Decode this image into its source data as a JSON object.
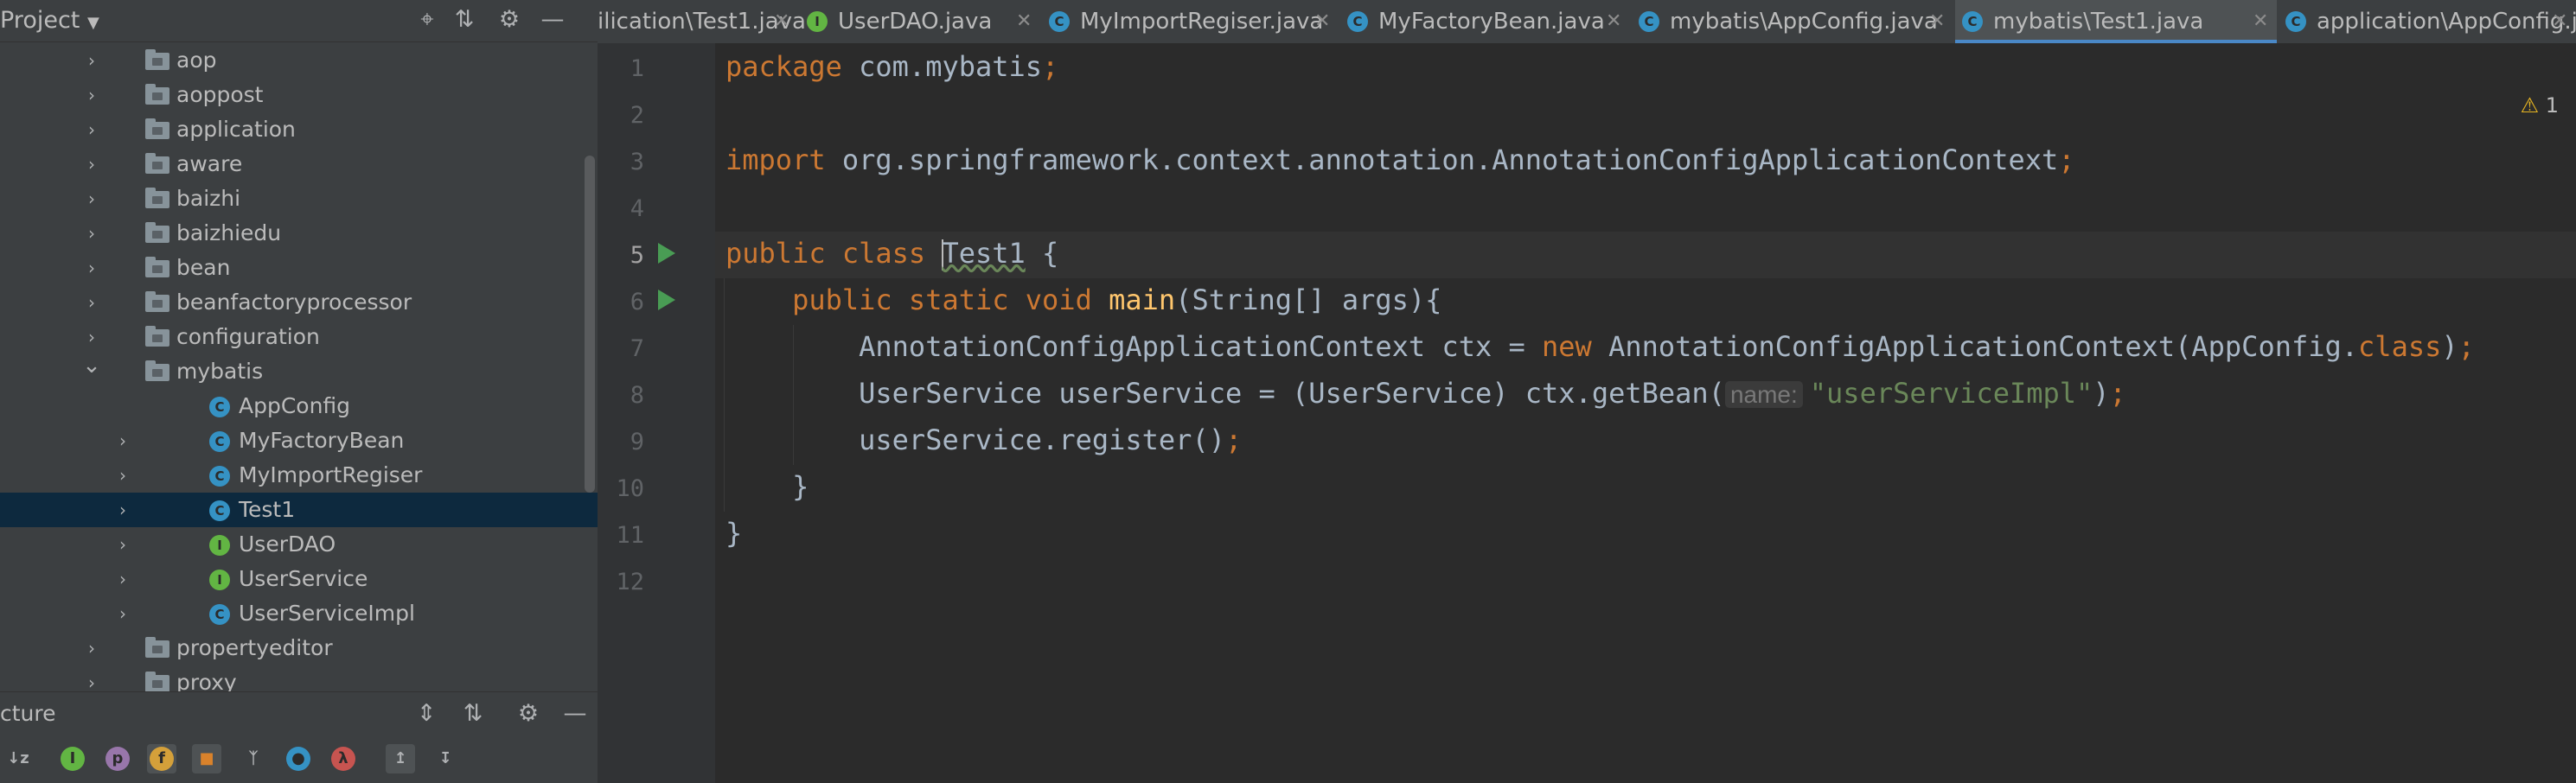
{
  "project_panel": {
    "title": "Project",
    "tree": [
      {
        "label": "aop",
        "type": "folder",
        "depth": 0,
        "expanded": false
      },
      {
        "label": "aoppost",
        "type": "folder",
        "depth": 0,
        "expanded": false
      },
      {
        "label": "application",
        "type": "folder",
        "depth": 0,
        "expanded": false
      },
      {
        "label": "aware",
        "type": "folder",
        "depth": 0,
        "expanded": false
      },
      {
        "label": "baizhi",
        "type": "folder",
        "depth": 0,
        "expanded": false
      },
      {
        "label": "baizhiedu",
        "type": "folder",
        "depth": 0,
        "expanded": false
      },
      {
        "label": "bean",
        "type": "folder",
        "depth": 0,
        "expanded": false
      },
      {
        "label": "beanfactoryprocessor",
        "type": "folder",
        "depth": 0,
        "expanded": false
      },
      {
        "label": "configuration",
        "type": "folder",
        "depth": 0,
        "expanded": false
      },
      {
        "label": "mybatis",
        "type": "folder",
        "depth": 0,
        "expanded": true
      },
      {
        "label": "AppConfig",
        "type": "class",
        "depth": 1,
        "expanded": null
      },
      {
        "label": "MyFactoryBean",
        "type": "class",
        "depth": 1,
        "expanded": false
      },
      {
        "label": "MyImportRegiser",
        "type": "class",
        "depth": 1,
        "expanded": false
      },
      {
        "label": "Test1",
        "type": "class",
        "depth": 1,
        "expanded": false,
        "selected": true
      },
      {
        "label": "UserDAO",
        "type": "interface",
        "depth": 1,
        "expanded": false
      },
      {
        "label": "UserService",
        "type": "interface",
        "depth": 1,
        "expanded": false
      },
      {
        "label": "UserServiceImpl",
        "type": "class",
        "depth": 1,
        "expanded": false
      },
      {
        "label": "propertyeditor",
        "type": "folder",
        "depth": 0,
        "expanded": false
      },
      {
        "label": "proxy",
        "type": "folder",
        "depth": 0,
        "expanded": false
      }
    ]
  },
  "structure_panel": {
    "title": "cture"
  },
  "tabs": [
    {
      "label": "ilication\\Test1.java",
      "icon": "class",
      "active": false
    },
    {
      "label": "UserDAO.java",
      "icon": "interface",
      "active": false
    },
    {
      "label": "MyImportRegiser.java",
      "icon": "class",
      "active": false
    },
    {
      "label": "MyFactoryBean.java",
      "icon": "class",
      "active": false
    },
    {
      "label": "mybatis\\AppConfig.java",
      "icon": "class",
      "active": false
    },
    {
      "label": "mybatis\\Test1.java",
      "icon": "class",
      "active": true
    },
    {
      "label": "application\\AppConfig.java",
      "icon": "class",
      "active": false
    }
  ],
  "editor": {
    "warning_count": "1",
    "line_numbers": [
      "1",
      "2",
      "3",
      "4",
      "5",
      "6",
      "7",
      "8",
      "9",
      "10",
      "11",
      "12"
    ],
    "lines": [
      [
        {
          "t": "package ",
          "c": "kw"
        },
        {
          "t": "com.mybatis",
          "c": ""
        },
        {
          "t": ";",
          "c": "kw"
        }
      ],
      [],
      [
        {
          "t": "import ",
          "c": "kw"
        },
        {
          "t": "org.springframework.context.annotation.AnnotationConfigApplicationContext",
          "c": ""
        },
        {
          "t": ";",
          "c": "kw"
        }
      ],
      [],
      [
        {
          "t": "public class ",
          "c": "kw"
        },
        {
          "t": "Test1",
          "c": "sq"
        },
        {
          "t": " {",
          "c": ""
        }
      ],
      [
        {
          "t": "    public static void ",
          "c": "kw"
        },
        {
          "t": "main",
          "c": "fn"
        },
        {
          "t": "(String[] args){",
          "c": ""
        }
      ],
      [
        {
          "t": "        AnnotationConfigApplicationContext ctx = ",
          "c": ""
        },
        {
          "t": "new ",
          "c": "kw"
        },
        {
          "t": "AnnotationConfigApplicationContext(AppConfig.",
          "c": ""
        },
        {
          "t": "class",
          "c": "kw"
        },
        {
          "t": ")",
          "c": ""
        },
        {
          "t": ";",
          "c": "kw"
        }
      ],
      [
        {
          "t": "        UserService userService = (UserService) ctx.getBean(",
          "c": ""
        },
        {
          "t": "name:",
          "c": "hint"
        },
        {
          "t": "\"userServiceImpl\"",
          "c": "str"
        },
        {
          "t": ")",
          "c": ""
        },
        {
          "t": ";",
          "c": "kw"
        }
      ],
      [
        {
          "t": "        userService.register()",
          "c": ""
        },
        {
          "t": ";",
          "c": "kw"
        }
      ],
      [
        {
          "t": "    }",
          "c": ""
        }
      ],
      [
        {
          "t": "}",
          "c": ""
        }
      ],
      []
    ]
  }
}
